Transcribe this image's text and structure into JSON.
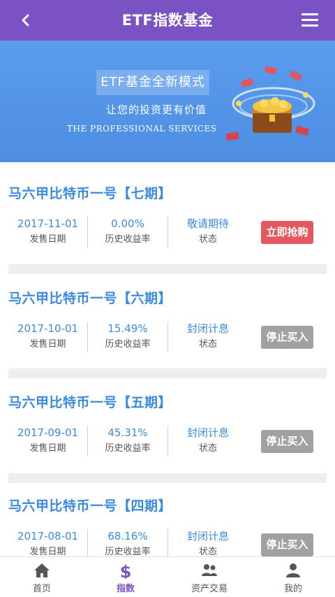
{
  "header": {
    "back_icon": "chevron-left-icon",
    "title": "ETF指数基金",
    "menu_icon": "hamburger-menu-icon"
  },
  "banner": {
    "tag": "ETF基金全新模式",
    "subtitle": "让您的投资更有价值",
    "english": "THE PROFESSIONAL SERVICES",
    "illustration": "treasure-chest-coins-illustration"
  },
  "funds": [
    {
      "name": "马六甲比特币一号【七期】",
      "date": "2017-11-01",
      "date_label": "发售日期",
      "rate": "0.00%",
      "rate_label": "历史收益率",
      "status": "敬请期待",
      "status_label": "状态",
      "action": "立即抢购",
      "action_color": "#e4595f"
    },
    {
      "name": "马六甲比特币一号【六期】",
      "date": "2017-10-01",
      "date_label": "发售日期",
      "rate": "15.49%",
      "rate_label": "历史收益率",
      "status": "封闭计息",
      "status_label": "状态",
      "action": "停止买入",
      "action_color": "#a1a1a1"
    },
    {
      "name": "马六甲比特币一号【五期】",
      "date": "2017-09-01",
      "date_label": "发售日期",
      "rate": "45.31%",
      "rate_label": "历史收益率",
      "status": "封闭计息",
      "status_label": "状态",
      "action": "停止买入",
      "action_color": "#a1a1a1"
    },
    {
      "name": "马六甲比特币一号【四期】",
      "date": "2017-08-01",
      "date_label": "发售日期",
      "rate": "68.16%",
      "rate_label": "历史收益率",
      "status": "封闭计息",
      "status_label": "状态",
      "action": "停止买入",
      "action_color": "#a1a1a1"
    }
  ],
  "tabbar": {
    "tabs": [
      {
        "label": "首页",
        "icon": "home-icon"
      },
      {
        "label": "指数",
        "icon": "dollar-icon",
        "active": true
      },
      {
        "label": "资产交易",
        "icon": "users-icon"
      },
      {
        "label": "我的",
        "icon": "user-icon"
      }
    ]
  },
  "colors": {
    "header_bg": "#7b52c4",
    "banner_bg": "#5a9cec",
    "accent_blue": "#3a8ae0",
    "buy_red": "#e4595f",
    "stop_grey": "#a1a1a1"
  }
}
